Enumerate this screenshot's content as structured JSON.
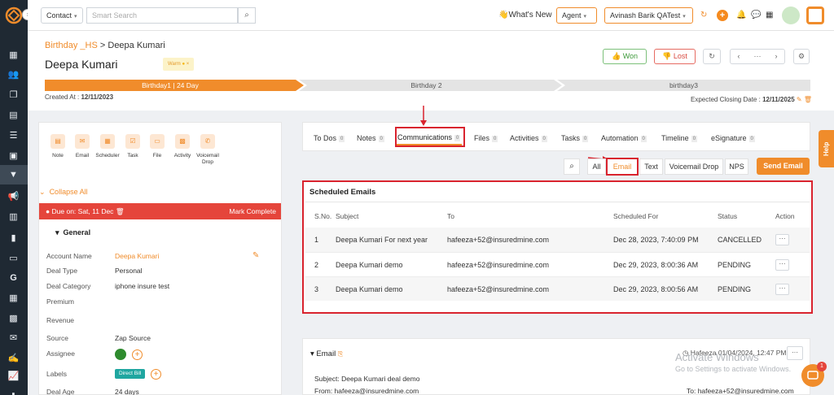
{
  "colors": {
    "accent": "#f08c2b",
    "sidebar": "#1f2933",
    "danger": "#e5453b",
    "highlight": "#d9232e",
    "success": "#3f9b3c"
  },
  "topbar": {
    "module_select": "Contact",
    "search_placeholder": "Smart Search",
    "whats_new": "What's New",
    "role_select": "Agent",
    "user_select": "Avinash Barik QATest"
  },
  "header": {
    "breadcrumb_root": "Birthday _HS",
    "breadcrumb_sep": ">",
    "breadcrumb_current": "Deepa Kumari",
    "deal_name": "Deepa Kumari",
    "warm_badge": "Warm",
    "won_label": "Won",
    "lost_label": "Lost",
    "stages": [
      "Birthday1 | 24 Day",
      "Birthday 2",
      "birthday3"
    ],
    "created_label": "Created At :",
    "created_value": "12/11/2023",
    "closing_label": "Expected Closing Date :",
    "closing_value": "12/11/2025"
  },
  "quick_actions": [
    "Note",
    "Email",
    "Scheduler",
    "Task",
    "File",
    "Activity",
    "Voicemail Drop"
  ],
  "left": {
    "collapse_all": "Collapse All",
    "due_text": "Due on: Sat, 11 Dec",
    "mark_complete": "Mark Complete",
    "section_general": "General",
    "fields": [
      {
        "label": "Account Name",
        "value": "Deepa Kumari"
      },
      {
        "label": "Deal Type",
        "value": "Personal"
      },
      {
        "label": "Deal Category",
        "value": "iphone insure test"
      },
      {
        "label": "Premium",
        "value": ""
      },
      {
        "label": "Revenue",
        "value": ""
      },
      {
        "label": "Source",
        "value": "Zap Source"
      },
      {
        "label": "Assignee",
        "value": ""
      },
      {
        "label": "Labels",
        "value": "Direct Bill"
      },
      {
        "label": "Deal Age",
        "value": "24 days"
      }
    ]
  },
  "tabs": [
    {
      "label": "To Dos",
      "count": "0"
    },
    {
      "label": "Notes",
      "count": "0"
    },
    {
      "label": "Communications",
      "count": "0"
    },
    {
      "label": "Files",
      "count": "0"
    },
    {
      "label": "Activities",
      "count": "0"
    },
    {
      "label": "Tasks",
      "count": "0"
    },
    {
      "label": "Automation",
      "count": "0"
    },
    {
      "label": "Timeline",
      "count": "0"
    },
    {
      "label": "eSignature",
      "count": "0"
    }
  ],
  "filters": [
    "All",
    "Email",
    "Text",
    "Voicemail Drop",
    "NPS"
  ],
  "send_email": "Send Email",
  "scheduled": {
    "title": "Scheduled Emails",
    "columns": [
      "S.No.",
      "Subject",
      "To",
      "Scheduled For",
      "Status",
      "Action"
    ],
    "rows": [
      {
        "sno": "1",
        "subject": "Deepa Kumari For next year",
        "to": "hafeeza+52@insuredmine.com",
        "scheduled": "Dec 28, 2023, 7:40:09 PM",
        "status": "CANCELLED"
      },
      {
        "sno": "2",
        "subject": "Deepa Kumari demo",
        "to": "hafeeza+52@insuredmine.com",
        "scheduled": "Dec 29, 2023, 8:00:36 AM",
        "status": "PENDING"
      },
      {
        "sno": "3",
        "subject": "Deepa Kumari demo",
        "to": "hafeeza+52@insuredmine.com",
        "scheduled": "Dec 29, 2023, 8:00:56 AM",
        "status": "PENDING"
      }
    ]
  },
  "email": {
    "title": "Email",
    "meta": "Hafeeza 01/04/2024, 12:47 PM",
    "subject": "Subject: Deepa Kumari deal demo",
    "from": "From: hafeeza@insuredmine.com",
    "to": "To: hafeeza+52@insuredmine.com"
  },
  "help_label": "Help",
  "chat_badge": "1",
  "watermark": {
    "line1": "Activate Windows",
    "line2": "Go to Settings to activate Windows."
  }
}
